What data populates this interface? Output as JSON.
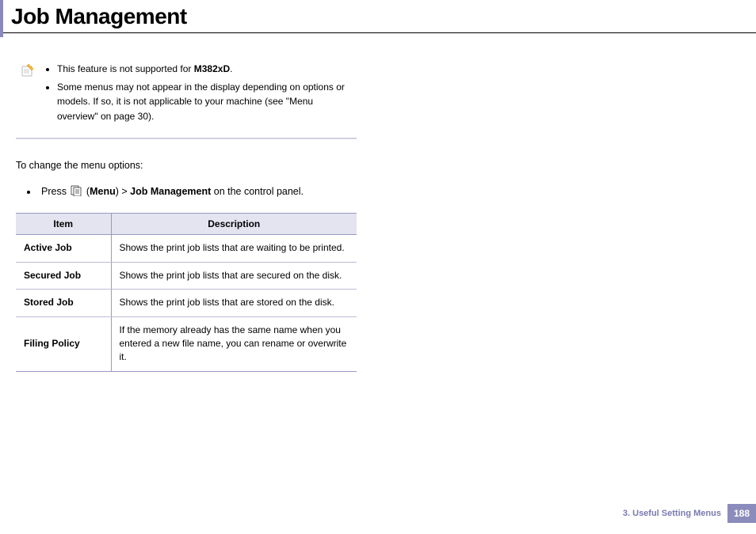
{
  "title": "Job Management",
  "notes": {
    "item1_prefix": "This feature is not supported for ",
    "item1_bold": "M382xD",
    "item1_suffix": ".",
    "item2": "Some menus may not appear in the display depending on options or models. If so, it is not applicable to your machine (see \"Menu overview\" on page 30)."
  },
  "intro": "To change the menu options:",
  "step": {
    "prefix": "Press ",
    "menu_open": "(",
    "menu_word": "Menu",
    "menu_close": ") > ",
    "menu_path": "Job Management",
    "suffix": " on the control panel."
  },
  "table": {
    "headers": {
      "item": "Item",
      "description": "Description"
    },
    "rows": [
      {
        "item": "Active Job",
        "desc": "Shows the print job lists that are waiting to be printed."
      },
      {
        "item": "Secured Job",
        "desc": "Shows the print job lists that are secured on the disk."
      },
      {
        "item": "Stored Job",
        "desc": "Shows the print job lists that are stored on the disk."
      },
      {
        "item": "Filing Policy",
        "desc": "If the memory already has the same name when you entered a new file name, you can rename or overwrite it."
      }
    ]
  },
  "footer": {
    "chapter": "3.  Useful Setting Menus",
    "page": "188"
  }
}
